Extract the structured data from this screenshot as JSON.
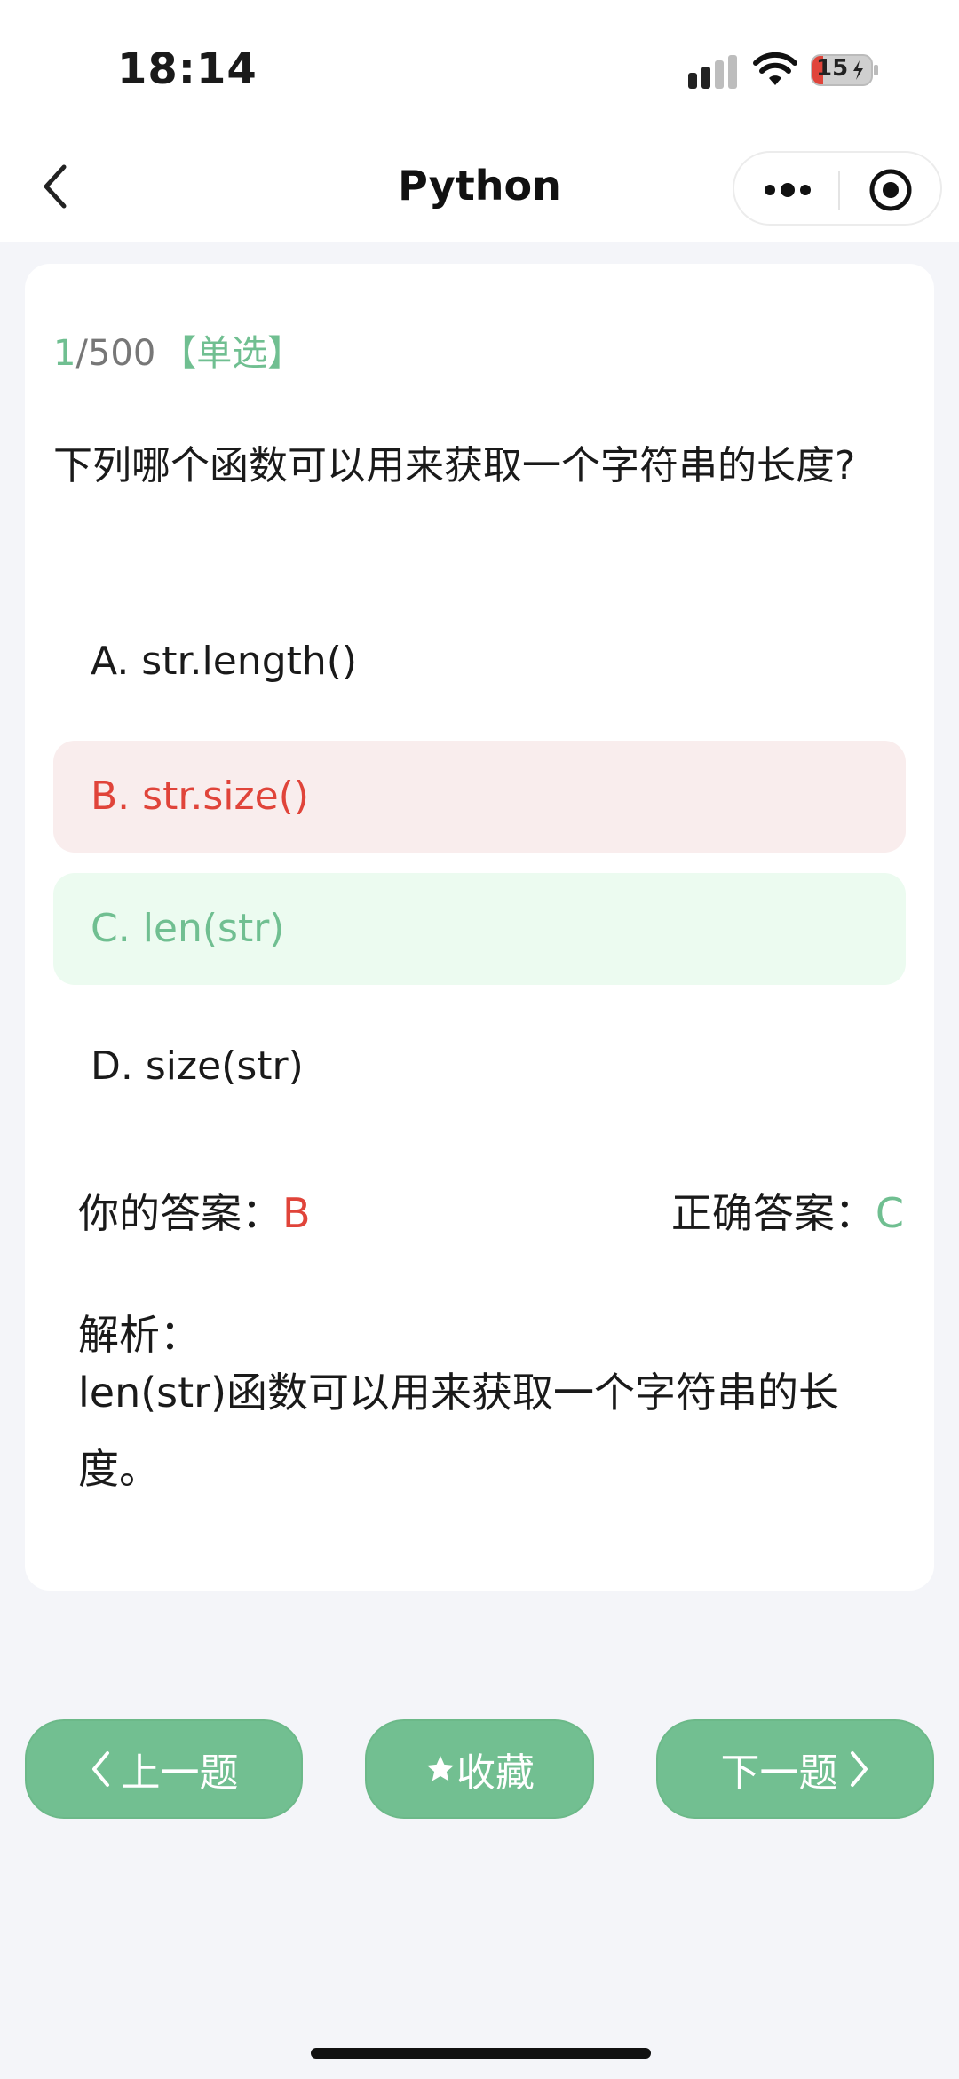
{
  "status_bar": {
    "time": "18:14",
    "battery": "15"
  },
  "nav": {
    "title": "Python"
  },
  "question": {
    "current": "1",
    "separator": "/",
    "total": "500",
    "type": "【单选】",
    "text": "下列哪个函数可以用来获取一个字符串的长度?"
  },
  "options": [
    {
      "label": "A. str.length()",
      "state": "normal"
    },
    {
      "label": "B. str.size()",
      "state": "wrong"
    },
    {
      "label": "C. len(str)",
      "state": "correct"
    },
    {
      "label": "D. size(str)",
      "state": "normal"
    }
  ],
  "result": {
    "your_label": "你的答案：",
    "your_value": "B",
    "correct_label": "正确答案：",
    "correct_value": "C"
  },
  "analysis": {
    "label": "解析：",
    "text": "len(str)函数可以用来获取一个字符串的长度。"
  },
  "buttons": {
    "prev": "上一题",
    "favorite": "收藏",
    "next": "下一题"
  },
  "colors": {
    "accent": "#70bf91",
    "wrong": "#e0443a",
    "wrong_bg": "#f9eded",
    "correct_bg": "#ecfbf0"
  },
  "icons": [
    "back-chevron-icon",
    "more-dots-icon",
    "target-icon",
    "star-icon",
    "chevron-left-icon",
    "chevron-right-icon",
    "signal-icon",
    "wifi-icon",
    "battery-icon"
  ]
}
